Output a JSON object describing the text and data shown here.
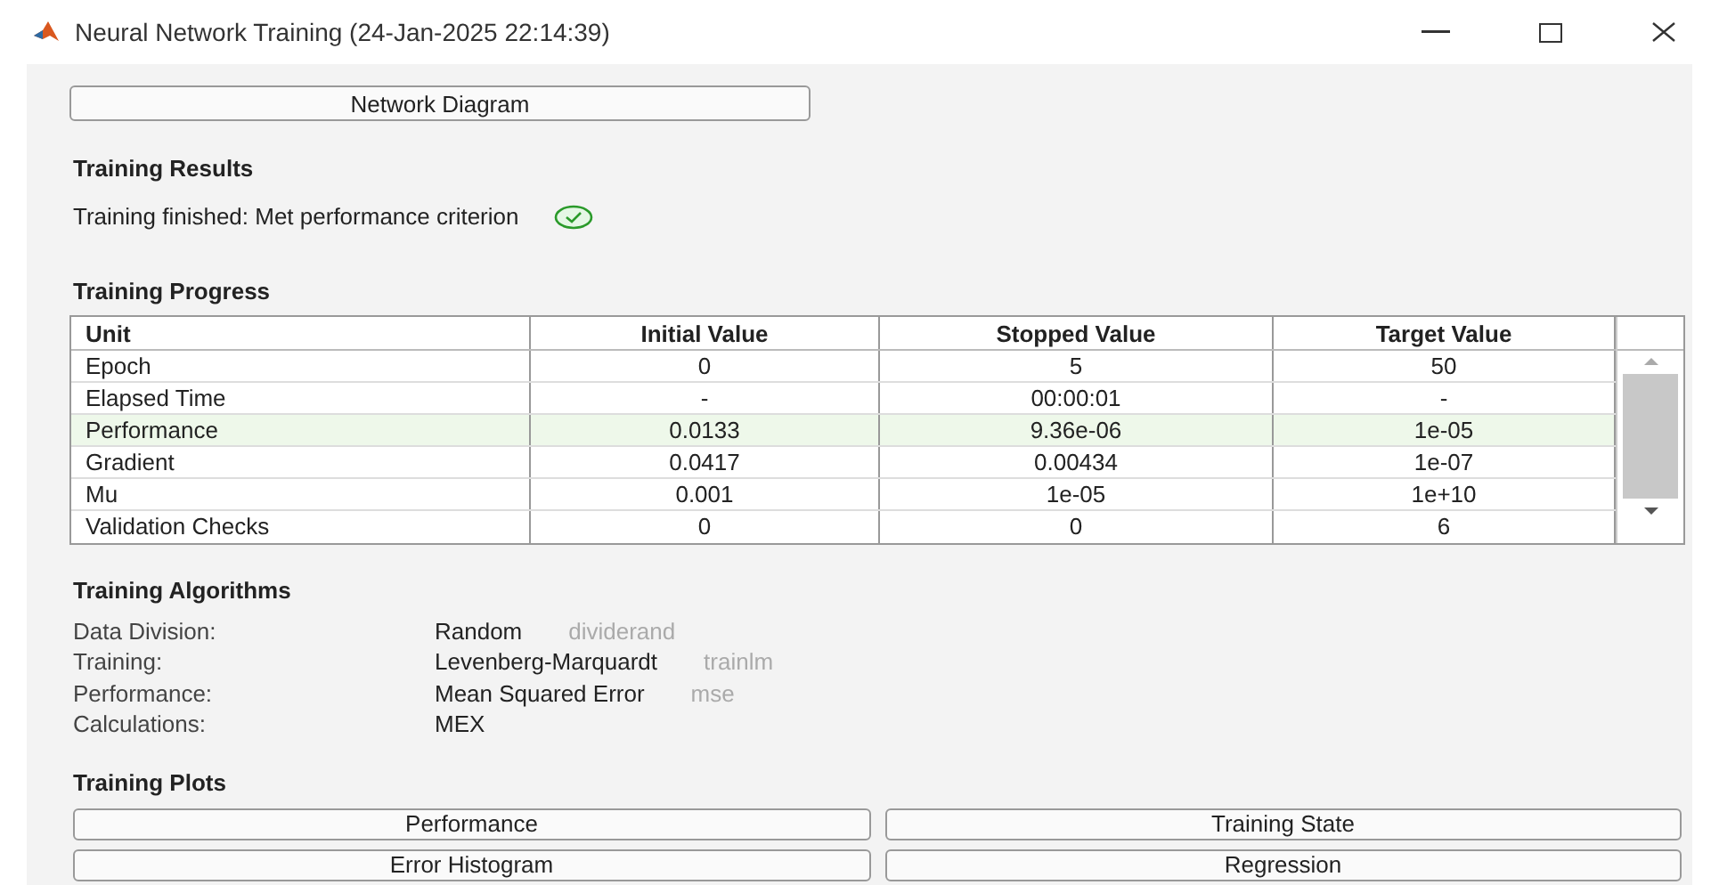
{
  "window": {
    "title": "Neural Network Training (24-Jan-2025 22:14:39)"
  },
  "network_diagram_button": "Network Diagram",
  "training_results": {
    "heading": "Training Results",
    "status": "Training finished: Met performance criterion",
    "success": true
  },
  "training_progress": {
    "heading": "Training Progress",
    "columns": [
      "Unit",
      "Initial Value",
      "Stopped Value",
      "Target Value"
    ],
    "rows": [
      {
        "cells": [
          "Epoch",
          "0",
          "5",
          "50"
        ],
        "highlighted": false
      },
      {
        "cells": [
          "Elapsed Time",
          "-",
          "00:00:01",
          "-"
        ],
        "highlighted": false
      },
      {
        "cells": [
          "Performance",
          "0.0133",
          "9.36e-06",
          "1e-05"
        ],
        "highlighted": true
      },
      {
        "cells": [
          "Gradient",
          "0.0417",
          "0.00434",
          "1e-07"
        ],
        "highlighted": false
      },
      {
        "cells": [
          "Mu",
          "0.001",
          "1e-05",
          "1e+10"
        ],
        "highlighted": false
      },
      {
        "cells": [
          "Validation Checks",
          "0",
          "0",
          "6"
        ],
        "highlighted": false
      }
    ]
  },
  "training_algorithms": {
    "heading": "Training Algorithms",
    "rows": [
      {
        "label": "Data Division:",
        "value": "Random",
        "function": "dividerand"
      },
      {
        "label": "Training:",
        "value": "Levenberg-Marquardt",
        "function": "trainlm"
      },
      {
        "label": "Performance:",
        "value": "Mean Squared Error",
        "function": "mse"
      },
      {
        "label": "Calculations:",
        "value": "MEX"
      }
    ]
  },
  "training_plots": {
    "heading": "Training Plots",
    "buttons": [
      "Performance",
      "Training State",
      "Error Histogram",
      "Regression"
    ]
  }
}
